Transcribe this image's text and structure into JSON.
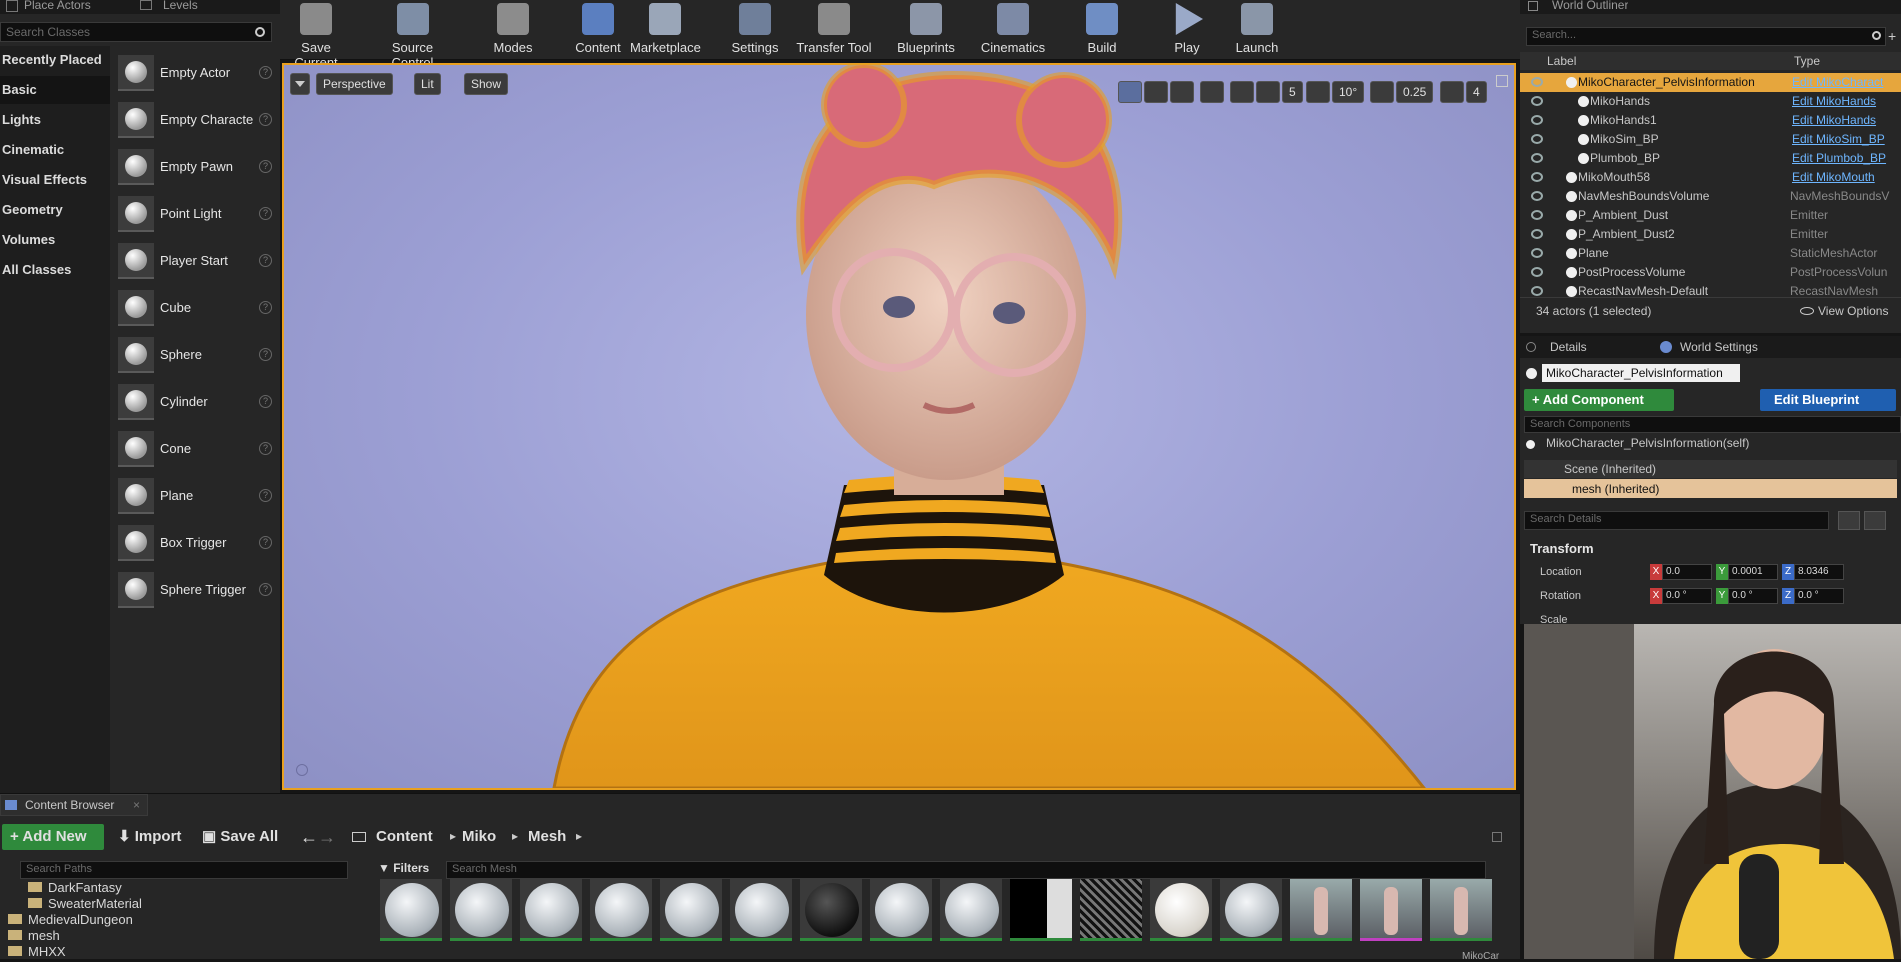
{
  "left_panel": {
    "tabs": [
      "Place Actors",
      "Levels"
    ],
    "search_placeholder": "Search Classes",
    "categories": [
      "Recently Placed",
      "Basic",
      "Lights",
      "Cinematic",
      "Visual Effects",
      "Geometry",
      "Volumes",
      "All Classes"
    ],
    "selected_category": "Basic",
    "actors": [
      "Empty Actor",
      "Empty Characte",
      "Empty Pawn",
      "Point Light",
      "Player Start",
      "Cube",
      "Sphere",
      "Cylinder",
      "Cone",
      "Plane",
      "Box Trigger",
      "Sphere Trigger"
    ]
  },
  "toolbar": {
    "items": [
      "Save Current",
      "Source Control",
      "Modes",
      "Content",
      "Marketplace",
      "Settings",
      "Transfer Tool",
      "Blueprints",
      "Cinematics",
      "Build",
      "Play",
      "Launch"
    ]
  },
  "viewport": {
    "buttons": {
      "perspective": "Perspective",
      "lit": "Lit",
      "show": "Show"
    },
    "snap": {
      "grid": "5",
      "rot": "10°",
      "scale": "0.25",
      "speed": "4"
    }
  },
  "outliner": {
    "title": "World Outliner",
    "search_placeholder": "Search...",
    "col_label": "Label",
    "col_type": "Type",
    "rows": [
      {
        "name": "MikoCharacter_PelvisInformation",
        "type": "Edit MikoCharact",
        "link": true,
        "sel": true,
        "indent": 1
      },
      {
        "name": "MikoHands",
        "type": "Edit MikoHands",
        "link": true,
        "indent": 2
      },
      {
        "name": "MikoHands1",
        "type": "Edit MikoHands",
        "link": true,
        "indent": 2
      },
      {
        "name": "MikoSim_BP",
        "type": "Edit MikoSim_BP",
        "link": true,
        "indent": 2
      },
      {
        "name": "Plumbob_BP",
        "type": "Edit Plumbob_BP",
        "link": true,
        "indent": 2
      },
      {
        "name": "MikoMouth58",
        "type": "Edit MikoMouth",
        "link": true,
        "indent": 1
      },
      {
        "name": "NavMeshBoundsVolume",
        "type": "NavMeshBoundsV",
        "indent": 1
      },
      {
        "name": "P_Ambient_Dust",
        "type": "Emitter",
        "indent": 1
      },
      {
        "name": "P_Ambient_Dust2",
        "type": "Emitter",
        "indent": 1
      },
      {
        "name": "Plane",
        "type": "StaticMeshActor",
        "indent": 1
      },
      {
        "name": "PostProcessVolume",
        "type": "PostProcessVolun",
        "indent": 1
      },
      {
        "name": "RecastNavMesh-Default",
        "type": "RecastNavMesh",
        "indent": 1
      }
    ],
    "footer": "34 actors (1 selected)",
    "view_options": "View Options"
  },
  "details": {
    "tabs": [
      "Details",
      "World Settings"
    ],
    "object_name": "MikoCharacter_PelvisInformation",
    "add_component": "Add Component",
    "edit_blueprint": "Edit Blueprint",
    "search_components": "Search Components",
    "self_row": "MikoCharacter_PelvisInformation(self)",
    "scene_row": "Scene (Inherited)",
    "mesh_row": "mesh (Inherited)",
    "search_details": "Search Details",
    "transform": "Transform",
    "location_label": "Location",
    "rotation_label": "Rotation",
    "scale_label": "Scale",
    "location": [
      "0.0",
      "0.0001",
      "8.0346"
    ],
    "rotation": [
      "0.0 °",
      "0.0 °",
      "0.0 °"
    ],
    "axes": [
      "X",
      "Y",
      "Z"
    ]
  },
  "content_browser": {
    "tab": "Content Browser",
    "add_new": "Add New",
    "import": "Import",
    "save_all": "Save All",
    "breadcrumb": [
      "Content",
      "Miko",
      "Mesh"
    ],
    "search_paths": "Search Paths",
    "filters": "Filters",
    "search_mesh": "Search Mesh",
    "folders": [
      "DarkFantasy",
      "SweaterMaterial",
      "MedievalDungeon",
      "mesh",
      "MHXX"
    ],
    "asset_labels": [
      "MikoCar"
    ]
  },
  "colors": {
    "accent": "#e8a020",
    "link": "#6eb6ff",
    "green": "#2f8a3c",
    "blue": "#1f5fb0"
  }
}
